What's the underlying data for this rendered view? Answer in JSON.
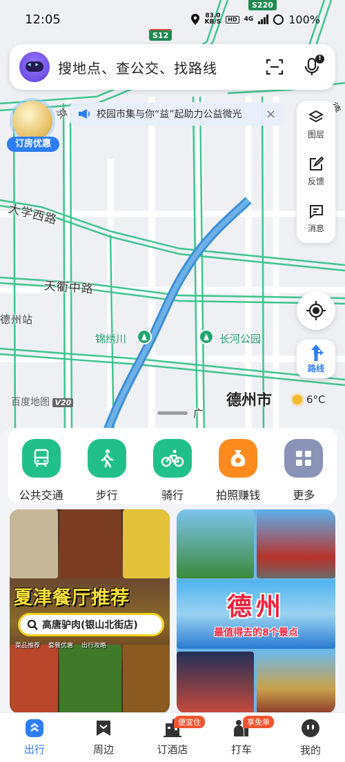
{
  "status": {
    "time": "12:05",
    "speed_value": "83.0",
    "speed_unit": "KB/S",
    "hd": "HD",
    "net": "4G",
    "battery": "100%"
  },
  "map": {
    "shields": [
      "S220",
      "S12"
    ],
    "labels": [
      "大学西路",
      "天衢中路",
      "德州站",
      "京",
      "德"
    ],
    "pois": [
      "锦绣川",
      "长河公园"
    ],
    "city": "德州市",
    "brand": "百度地图",
    "brand_version": "V20",
    "fragment": "广"
  },
  "search": {
    "placeholder": "搜地点、查公交、找路线",
    "mic_badge": "!"
  },
  "promo": {
    "tag": "订房优惠"
  },
  "notice": {
    "text": "校园市集与你“益”起助力公益微光",
    "close": "×"
  },
  "tools": {
    "layers": "图层",
    "feedback": "反馈",
    "messages": "消息"
  },
  "route_btn": {
    "label": "路线"
  },
  "weather": {
    "temp": "6°C"
  },
  "quick": [
    {
      "label": "公共交通",
      "color": "#21c08a"
    },
    {
      "label": "步行",
      "color": "#21c08a"
    },
    {
      "label": "骑行",
      "color": "#21c08a"
    },
    {
      "label": "拍照赚钱",
      "color": "#ff8a1e"
    },
    {
      "label": "更多",
      "color": "#8993b8"
    }
  ],
  "cards": {
    "food": {
      "title": "夏津餐厅推荐",
      "search": "高唐驴肉(银山北街店)",
      "tags": [
        "菜品推荐",
        "套餐优惠",
        "出行攻略"
      ]
    },
    "tour": {
      "title": "德州",
      "subtitle": "最值得去的8个景点"
    }
  },
  "tabs": [
    {
      "label": "出行",
      "badge": ""
    },
    {
      "label": "周边",
      "badge": ""
    },
    {
      "label": "订酒店",
      "badge": "便宜住"
    },
    {
      "label": "打车",
      "badge": "享免单"
    },
    {
      "label": "我的",
      "badge": ""
    }
  ]
}
